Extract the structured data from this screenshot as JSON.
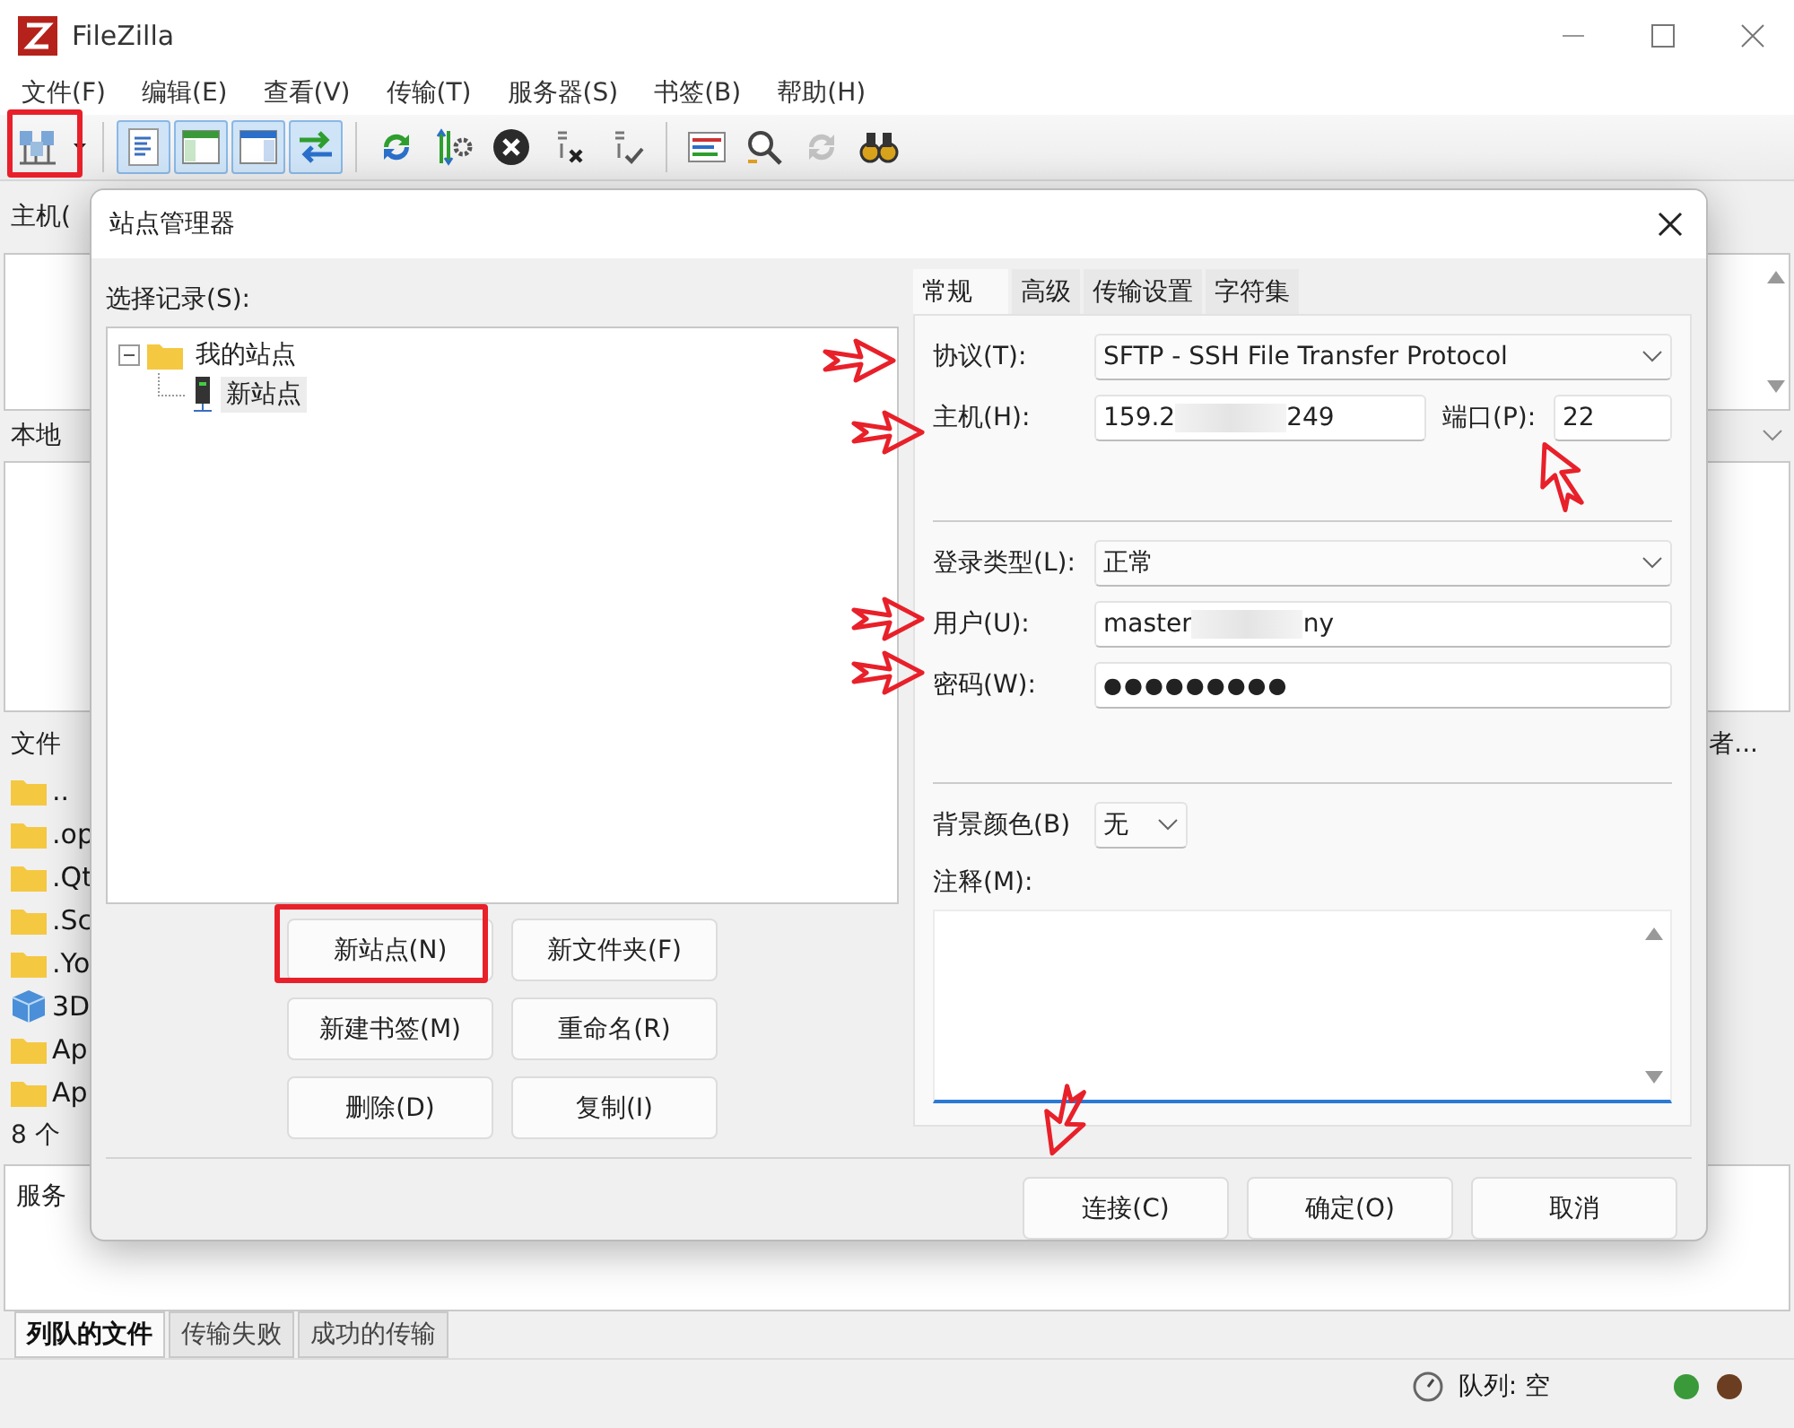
{
  "window": {
    "title": "FileZilla"
  },
  "menu": [
    "文件(F)",
    "编辑(E)",
    "查看(V)",
    "传输(T)",
    "服务器(S)",
    "书签(B)",
    "帮助(H)"
  ],
  "toolbar": [
    [
      {
        "kind": "site-manager",
        "pressed": false,
        "disabled": false
      },
      {
        "kind": "dropdown",
        "pressed": false,
        "disabled": false
      }
    ],
    [
      {
        "kind": "message-log",
        "pressed": true,
        "disabled": false
      },
      {
        "kind": "local-tree",
        "pressed": true,
        "disabled": false
      },
      {
        "kind": "remote-tree",
        "pressed": true,
        "disabled": false
      },
      {
        "kind": "transfer-queue",
        "pressed": true,
        "disabled": false
      }
    ],
    [
      {
        "kind": "refresh",
        "pressed": false,
        "disabled": false
      },
      {
        "kind": "process-queue",
        "pressed": false,
        "disabled": false
      },
      {
        "kind": "cancel",
        "pressed": false,
        "disabled": false
      },
      {
        "kind": "disconnect",
        "pressed": false,
        "disabled": false
      },
      {
        "kind": "reconnect",
        "pressed": false,
        "disabled": false
      }
    ],
    [
      {
        "kind": "filter",
        "pressed": false,
        "disabled": false
      },
      {
        "kind": "compare",
        "pressed": false,
        "disabled": false
      },
      {
        "kind": "sync",
        "pressed": false,
        "disabled": true
      },
      {
        "kind": "search",
        "pressed": false,
        "disabled": false
      }
    ]
  ],
  "background": {
    "host_label": "主机(",
    "local_site_label": "本地",
    "file_header": "文件",
    "remote_header": "者...",
    "files": [
      {
        "kind": "folder",
        "name": ".."
      },
      {
        "kind": "folder",
        "name": ".op"
      },
      {
        "kind": "folder",
        "name": ".Qt"
      },
      {
        "kind": "folder",
        "name": ".Sc"
      },
      {
        "kind": "folder",
        "name": ".Yo"
      },
      {
        "kind": "cube",
        "name": "3D"
      },
      {
        "kind": "folder",
        "name": "Ap"
      },
      {
        "kind": "folder",
        "name": "Ap"
      }
    ],
    "file_count": "8 个",
    "queue_header": "服务"
  },
  "queue_tabs": [
    {
      "label": "列队的文件",
      "selected": true
    },
    {
      "label": "传输失败",
      "selected": false
    },
    {
      "label": "成功的传输",
      "selected": false
    }
  ],
  "status_bar": {
    "queue": "队列: 空",
    "lights": [
      {
        "color": "#3a9a3a"
      },
      {
        "color": "#6b3e22"
      }
    ]
  },
  "dialog": {
    "title": "站点管理器",
    "tree_label": "选择记录(S):",
    "tree": [
      {
        "kind": "folder",
        "label": "我的站点",
        "expanded": true,
        "selected": false,
        "children": [
          {
            "kind": "site",
            "label": "新站点",
            "selected": true
          }
        ]
      }
    ],
    "buttons": [
      "新站点(N)",
      "新文件夹(F)",
      "新建书签(M)",
      "重命名(R)",
      "删除(D)",
      "复制(I)"
    ],
    "tabs": [
      {
        "label": "常规",
        "selected": true
      },
      {
        "label": "高级",
        "selected": false
      },
      {
        "label": "传输设置",
        "selected": false
      },
      {
        "label": "字符集",
        "selected": false
      }
    ],
    "protocol": {
      "label": "协议(T):",
      "value": "SFTP - SSH File Transfer Protocol"
    },
    "host": {
      "label": "主机(H):",
      "value": "159.2",
      "value_end": "249"
    },
    "port": {
      "label": "端口(P):",
      "value": "22"
    },
    "logon_type": {
      "label": "登录类型(L):",
      "value": "正常"
    },
    "user": {
      "label": "用户(U):",
      "value": "master",
      "value_end": "ny"
    },
    "password": {
      "label": "密码(W):",
      "value": "●●●●●●●●●"
    },
    "background_color": {
      "label": "背景颜色(B)",
      "value": "无"
    },
    "comments": {
      "label": "注释(M):"
    },
    "footer_buttons": [
      "连接(C)",
      "确定(O)",
      "取消"
    ]
  }
}
